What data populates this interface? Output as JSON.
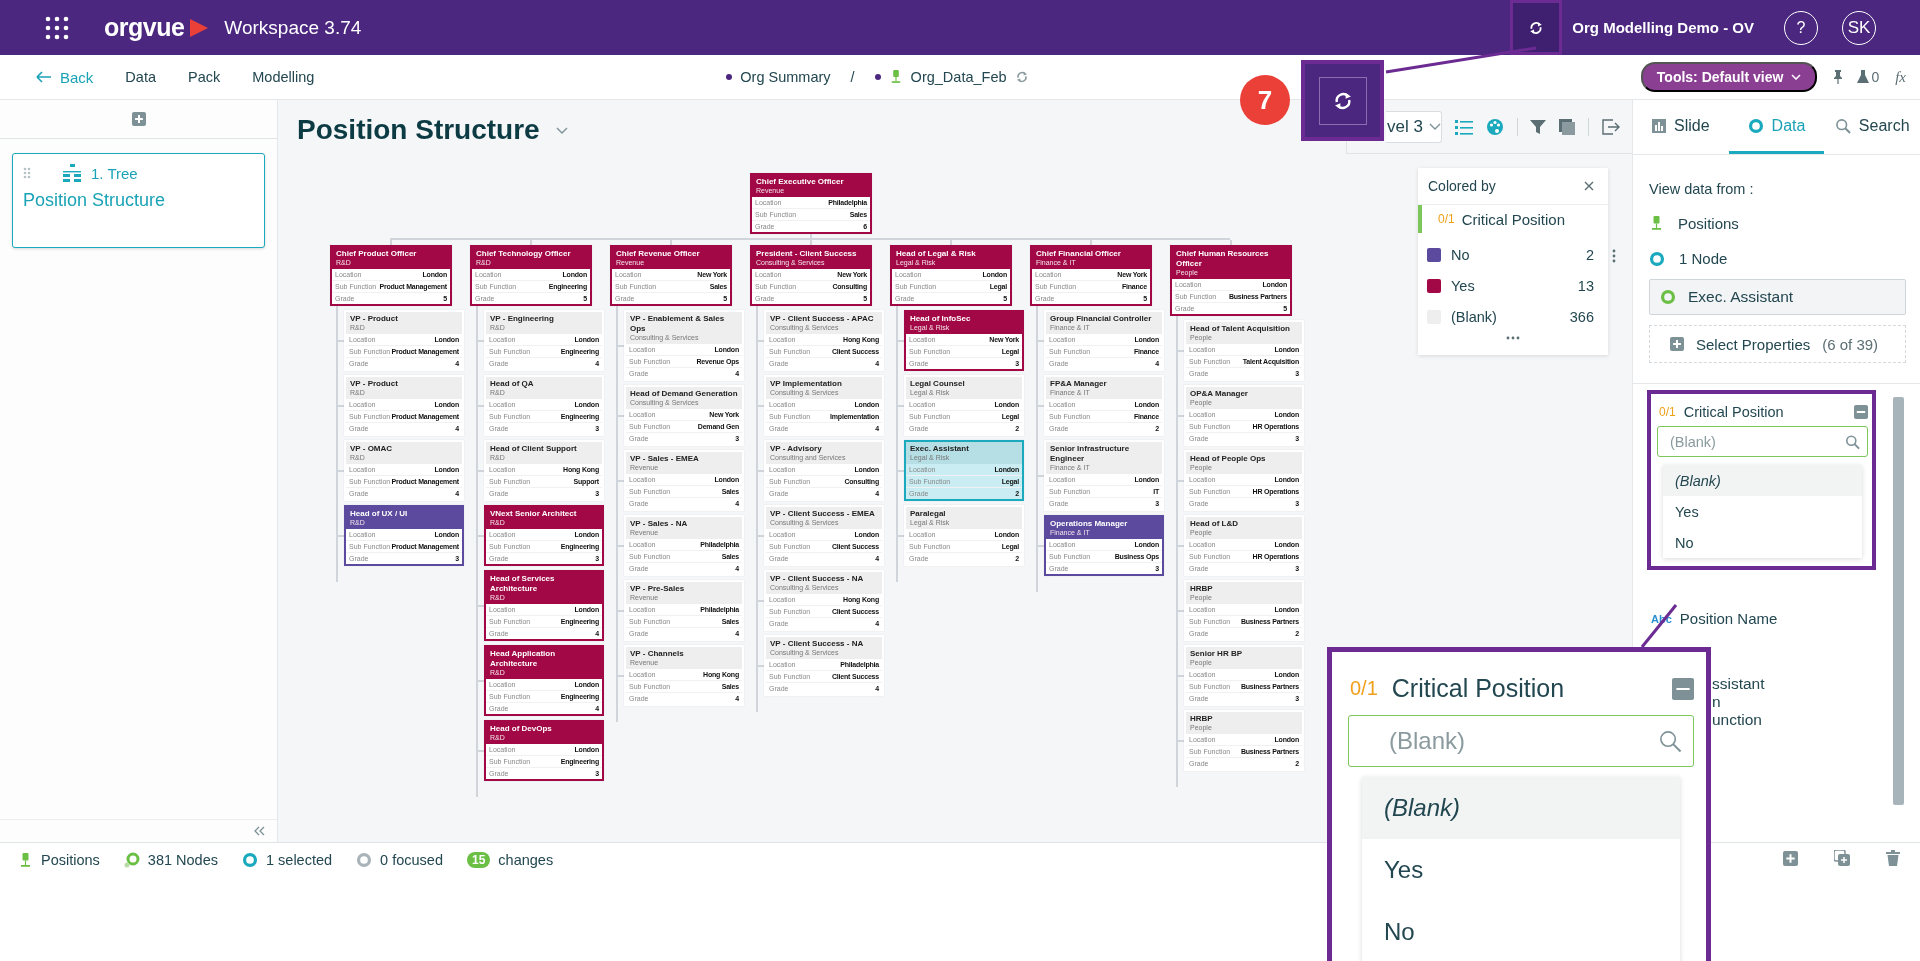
{
  "top_bar": {
    "app_name": "orgvue",
    "workspace": "Workspace 3.74",
    "workspace_name": "Org Modelling Demo - OV",
    "help": "?",
    "user_initials": "SK"
  },
  "nav": {
    "back": "Back",
    "links": [
      "Data",
      "Pack",
      "Modelling"
    ],
    "breadcrumb": [
      "Org Summary",
      "Org_Data_Feb"
    ],
    "separator": "/",
    "tools_button": "Tools: Default view",
    "flask_count": "0",
    "formula": "fx"
  },
  "slides_panel": {
    "slides": [
      {
        "number_label": "1. Tree",
        "title": "Position Structure",
        "selected": true
      }
    ]
  },
  "view": {
    "title": "Position Structure",
    "level_select": "vel 3"
  },
  "legend": {
    "title": "Colored by",
    "property_type": "0/1",
    "property": "Critical Position",
    "entries": [
      {
        "label": "No",
        "count": "2",
        "color": "#5c4a9e"
      },
      {
        "label": "Yes",
        "count": "13",
        "color": "#a10845"
      },
      {
        "label": "(Blank)",
        "count": "366",
        "color": "#eeeeee"
      }
    ]
  },
  "org_chart": {
    "root": {
      "title": "Chief Executive Officer",
      "function": "Revenue",
      "fields": [
        [
          "Location",
          "Philadelphia"
        ],
        [
          "Sub Function",
          "Sales"
        ],
        [
          "Grade",
          "6"
        ]
      ],
      "color": "#a10845",
      "selected": false,
      "children": [
        {
          "title": "Chief Product Officer",
          "function": "R&D",
          "fields": [
            [
              "Location",
              "London"
            ],
            [
              "Sub Function",
              "Product Management"
            ],
            [
              "Grade",
              "5"
            ]
          ],
          "color": "#a10845",
          "selected": false,
          "children": [
            {
              "title": "VP - Product",
              "function": "R&D",
              "fields": [
                [
                  "Location",
                  "London"
                ],
                [
                  "Sub Function",
                  "Product Management"
                ],
                [
                  "Grade",
                  "4"
                ]
              ],
              "selected": false
            },
            {
              "title": "VP - Product",
              "function": "R&D",
              "fields": [
                [
                  "Location",
                  "London"
                ],
                [
                  "Sub Function",
                  "Product Management"
                ],
                [
                  "Grade",
                  "4"
                ]
              ],
              "selected": false
            },
            {
              "title": "VP - OMAC",
              "function": "R&D",
              "fields": [
                [
                  "Location",
                  "London"
                ],
                [
                  "Sub Function",
                  "Product Management"
                ],
                [
                  "Grade",
                  "4"
                ]
              ],
              "selected": false
            },
            {
              "title": "Head of UX / UI",
              "function": "R&D",
              "fields": [
                [
                  "Location",
                  "London"
                ],
                [
                  "Sub Function",
                  "Product Management"
                ],
                [
                  "Grade",
                  "3"
                ]
              ],
              "color": "#5c4a9e",
              "selected": false
            }
          ]
        },
        {
          "title": "Chief Technology Officer",
          "function": "R&D",
          "fields": [
            [
              "Location",
              "London"
            ],
            [
              "Sub Function",
              "Engineering"
            ],
            [
              "Grade",
              "5"
            ]
          ],
          "color": "#a10845",
          "selected": false,
          "children": [
            {
              "title": "VP - Engineering",
              "function": "R&D",
              "fields": [
                [
                  "Location",
                  "London"
                ],
                [
                  "Sub Function",
                  "Engineering"
                ],
                [
                  "Grade",
                  "4"
                ]
              ],
              "selected": false
            },
            {
              "title": "Head of QA",
              "function": "R&D",
              "fields": [
                [
                  "Location",
                  "London"
                ],
                [
                  "Sub Function",
                  "Engineering"
                ],
                [
                  "Grade",
                  "3"
                ]
              ],
              "selected": false
            },
            {
              "title": "Head of Client Support",
              "function": "R&D",
              "fields": [
                [
                  "Location",
                  "Hong Kong"
                ],
                [
                  "Sub Function",
                  "Support"
                ],
                [
                  "Grade",
                  "3"
                ]
              ],
              "selected": false
            },
            {
              "title": "VNext Senior Architect",
              "function": "R&D",
              "fields": [
                [
                  "Location",
                  "London"
                ],
                [
                  "Sub Function",
                  "Engineering"
                ],
                [
                  "Grade",
                  "3"
                ]
              ],
              "color": "#a10845",
              "selected": false
            },
            {
              "title": "Head of Services Architecture",
              "function": "R&D",
              "fields": [
                [
                  "Location",
                  "London"
                ],
                [
                  "Sub Function",
                  "Engineering"
                ],
                [
                  "Grade",
                  "4"
                ]
              ],
              "color": "#a10845",
              "selected": false
            },
            {
              "title": "Head Application Architecture",
              "function": "R&D",
              "fields": [
                [
                  "Location",
                  "London"
                ],
                [
                  "Sub Function",
                  "Engineering"
                ],
                [
                  "Grade",
                  "4"
                ]
              ],
              "color": "#a10845",
              "selected": false
            },
            {
              "title": "Head of DevOps",
              "function": "R&D",
              "fields": [
                [
                  "Location",
                  "London"
                ],
                [
                  "Sub Function",
                  "Engineering"
                ],
                [
                  "Grade",
                  "3"
                ]
              ],
              "color": "#a10845",
              "selected": false
            }
          ]
        },
        {
          "title": "Chief Revenue Officer",
          "function": "Revenue",
          "fields": [
            [
              "Location",
              "New York"
            ],
            [
              "Sub Function",
              "Sales"
            ],
            [
              "Grade",
              "5"
            ]
          ],
          "color": "#a10845",
          "selected": false,
          "children": [
            {
              "title": "VP - Enablement & Sales Ops",
              "function": "Consulting & Services",
              "fields": [
                [
                  "Location",
                  "London"
                ],
                [
                  "Sub Function",
                  "Revenue Ops"
                ],
                [
                  "Grade",
                  "4"
                ]
              ],
              "selected": false
            },
            {
              "title": "Head of Demand Generation",
              "function": "Consulting & Services",
              "fields": [
                [
                  "Location",
                  "New York"
                ],
                [
                  "Sub Function",
                  "Demand Gen"
                ],
                [
                  "Grade",
                  "3"
                ]
              ],
              "selected": false
            },
            {
              "title": "VP - Sales - EMEA",
              "function": "Revenue",
              "fields": [
                [
                  "Location",
                  "London"
                ],
                [
                  "Sub Function",
                  "Sales"
                ],
                [
                  "Grade",
                  "4"
                ]
              ],
              "selected": false
            },
            {
              "title": "VP - Sales - NA",
              "function": "Revenue",
              "fields": [
                [
                  "Location",
                  "Philadelphia"
                ],
                [
                  "Sub Function",
                  "Sales"
                ],
                [
                  "Grade",
                  "4"
                ]
              ],
              "selected": false
            },
            {
              "title": "VP - Pre-Sales",
              "function": "Revenue",
              "fields": [
                [
                  "Location",
                  "Philadelphia"
                ],
                [
                  "Sub Function",
                  "Sales"
                ],
                [
                  "Grade",
                  "4"
                ]
              ],
              "selected": false
            },
            {
              "title": "VP - Channels",
              "function": "Revenue",
              "fields": [
                [
                  "Location",
                  "Hong Kong"
                ],
                [
                  "Sub Function",
                  "Sales"
                ],
                [
                  "Grade",
                  "4"
                ]
              ],
              "selected": false
            }
          ]
        },
        {
          "title": "President - Client Success",
          "function": "Consulting & Services",
          "fields": [
            [
              "Location",
              "New York"
            ],
            [
              "Sub Function",
              "Consulting"
            ],
            [
              "Grade",
              "5"
            ]
          ],
          "color": "#a10845",
          "selected": false,
          "children": [
            {
              "title": "VP - Client Success - APAC",
              "function": "Consulting & Services",
              "fields": [
                [
                  "Location",
                  "Hong Kong"
                ],
                [
                  "Sub Function",
                  "Client Success"
                ],
                [
                  "Grade",
                  "4"
                ]
              ],
              "selected": false
            },
            {
              "title": "VP Implementation",
              "function": "Consulting & Services",
              "fields": [
                [
                  "Location",
                  "London"
                ],
                [
                  "Sub Function",
                  "Implementation"
                ],
                [
                  "Grade",
                  "4"
                ]
              ],
              "selected": false
            },
            {
              "title": "VP - Advisory",
              "function": "Consulting and Services",
              "fields": [
                [
                  "Location",
                  "London"
                ],
                [
                  "Sub Function",
                  "Consulting"
                ],
                [
                  "Grade",
                  "4"
                ]
              ],
              "selected": false
            },
            {
              "title": "VP - Client Success - EMEA",
              "function": "Consulting & Services",
              "fields": [
                [
                  "Location",
                  "London"
                ],
                [
                  "Sub Function",
                  "Client Success"
                ],
                [
                  "Grade",
                  "4"
                ]
              ],
              "selected": false
            },
            {
              "title": "VP - Client Success - NA",
              "function": "Consulting & Services",
              "fields": [
                [
                  "Location",
                  "Hong Kong"
                ],
                [
                  "Sub Function",
                  "Client Success"
                ],
                [
                  "Grade",
                  "4"
                ]
              ],
              "selected": false
            },
            {
              "title": "VP - Client Success - NA",
              "function": "Consulting & Services",
              "fields": [
                [
                  "Location",
                  "Philadelphia"
                ],
                [
                  "Sub Function",
                  "Client Success"
                ],
                [
                  "Grade",
                  "4"
                ]
              ],
              "selected": false
            }
          ]
        },
        {
          "title": "Head of Legal & Risk",
          "function": "Legal & Risk",
          "fields": [
            [
              "Location",
              "London"
            ],
            [
              "Sub Function",
              "Legal"
            ],
            [
              "Grade",
              "5"
            ]
          ],
          "color": "#a10845",
          "selected": false,
          "children": [
            {
              "title": "Head of InfoSec",
              "function": "Legal & Risk",
              "fields": [
                [
                  "Location",
                  "New York"
                ],
                [
                  "Sub Function",
                  "Legal"
                ],
                [
                  "Grade",
                  "3"
                ]
              ],
              "color": "#a10845",
              "selected": false
            },
            {
              "title": "Legal Counsel",
              "function": "Legal & Risk",
              "fields": [
                [
                  "Location",
                  "London"
                ],
                [
                  "Sub Function",
                  "Legal"
                ],
                [
                  "Grade",
                  "2"
                ]
              ],
              "selected": false
            },
            {
              "title": "Exec. Assistant",
              "function": "Legal & Risk",
              "fields": [
                [
                  "Location",
                  "London"
                ],
                [
                  "Sub Function",
                  "Legal"
                ],
                [
                  "Grade",
                  "2"
                ]
              ],
              "selected": true
            },
            {
              "title": "Paralegal",
              "function": "Legal & Risk",
              "fields": [
                [
                  "Location",
                  "London"
                ],
                [
                  "Sub Function",
                  "Legal"
                ],
                [
                  "Grade",
                  "2"
                ]
              ],
              "selected": false
            }
          ]
        },
        {
          "title": "Chief Financial Officer",
          "function": "Finance & IT",
          "fields": [
            [
              "Location",
              "New York"
            ],
            [
              "Sub Function",
              "Finance"
            ],
            [
              "Grade",
              "5"
            ]
          ],
          "color": "#a10845",
          "selected": false,
          "children": [
            {
              "title": "Group Financial Controller",
              "function": "Finance & IT",
              "fields": [
                [
                  "Location",
                  "London"
                ],
                [
                  "Sub Function",
                  "Finance"
                ],
                [
                  "Grade",
                  "4"
                ]
              ],
              "selected": false
            },
            {
              "title": "FP&A Manager",
              "function": "Finance & IT",
              "fields": [
                [
                  "Location",
                  "London"
                ],
                [
                  "Sub Function",
                  "Finance"
                ],
                [
                  "Grade",
                  "2"
                ]
              ],
              "selected": false
            },
            {
              "title": "Senior Infrastructure Engineer",
              "function": "Finance & IT",
              "fields": [
                [
                  "Location",
                  "London"
                ],
                [
                  "Sub Function",
                  "IT"
                ],
                [
                  "Grade",
                  "3"
                ]
              ],
              "selected": false
            },
            {
              "title": "Operations Manager",
              "function": "Finance & IT",
              "fields": [
                [
                  "Location",
                  "London"
                ],
                [
                  "Sub Function",
                  "Business Ops"
                ],
                [
                  "Grade",
                  "3"
                ]
              ],
              "color": "#5c4a9e",
              "selected": false
            }
          ]
        },
        {
          "title": "Chief Human Resources Officer",
          "function": "People",
          "fields": [
            [
              "Location",
              "London"
            ],
            [
              "Sub Function",
              "Business Partners"
            ],
            [
              "Grade",
              "5"
            ]
          ],
          "color": "#a10845",
          "selected": false,
          "children": [
            {
              "title": "Head of Talent Acquisition",
              "function": "People",
              "fields": [
                [
                  "Location",
                  "London"
                ],
                [
                  "Sub Function",
                  "Talent Acquisition"
                ],
                [
                  "Grade",
                  "3"
                ]
              ],
              "selected": false
            },
            {
              "title": "OP&A Manager",
              "function": "People",
              "fields": [
                [
                  "Location",
                  "London"
                ],
                [
                  "Sub Function",
                  "HR Operations"
                ],
                [
                  "Grade",
                  "3"
                ]
              ],
              "selected": false
            },
            {
              "title": "Head of People Ops",
              "function": "People",
              "fields": [
                [
                  "Location",
                  "London"
                ],
                [
                  "Sub Function",
                  "HR Operations"
                ],
                [
                  "Grade",
                  "3"
                ]
              ],
              "selected": false
            },
            {
              "title": "Head of L&D",
              "function": "People",
              "fields": [
                [
                  "Location",
                  "London"
                ],
                [
                  "Sub Function",
                  "HR Operations"
                ],
                [
                  "Grade",
                  "3"
                ]
              ],
              "selected": false
            },
            {
              "title": "HRBP",
              "function": "People",
              "fields": [
                [
                  "Location",
                  "London"
                ],
                [
                  "Sub Function",
                  "Business Partners"
                ],
                [
                  "Grade",
                  "2"
                ]
              ],
              "selected": false
            },
            {
              "title": "Senior HR BP",
              "function": "People",
              "fields": [
                [
                  "Location",
                  "London"
                ],
                [
                  "Sub Function",
                  "Business Partners"
                ],
                [
                  "Grade",
                  "3"
                ]
              ],
              "selected": false
            },
            {
              "title": "HRBP",
              "function": "People",
              "fields": [
                [
                  "Location",
                  "London"
                ],
                [
                  "Sub Function",
                  "Business Partners"
                ],
                [
                  "Grade",
                  "2"
                ]
              ],
              "selected": false
            }
          ]
        }
      ]
    }
  },
  "right_panel": {
    "tabs": [
      {
        "label": "Slide",
        "selected": false
      },
      {
        "label": "Data",
        "selected": true
      },
      {
        "label": "Search",
        "selected": false
      }
    ],
    "view_data_from": "View data from :",
    "dataset": "Positions",
    "node_count": "1 Node",
    "node_name": "Exec. Assistant",
    "select_properties": "Select Properties",
    "properties_count": "(6 of 39)",
    "filter": {
      "property_type": "0/1",
      "property": "Critical Position",
      "placeholder": "(Blank)",
      "options": [
        {
          "label": "(Blank)",
          "selected": true
        },
        {
          "label": "Yes",
          "selected": false
        },
        {
          "label": "No",
          "selected": false
        }
      ]
    },
    "property_type": "Abc",
    "property_name": "Position Name",
    "partial_texts": [
      "ssistant",
      "n",
      "unction"
    ]
  },
  "status_bar": {
    "dataset": "Positions",
    "nodes": "381 Nodes",
    "selected": "1 selected",
    "focused": "0 focused",
    "changes_count": "15",
    "changes": "changes"
  },
  "callouts": {
    "step_number": "7",
    "magnified_filter": {
      "property_type": "0/1",
      "property": "Critical Position",
      "placeholder": "(Blank)",
      "options": [
        {
          "label": "(Blank)",
          "selected": true
        },
        {
          "label": "Yes",
          "selected": false
        },
        {
          "label": "No",
          "selected": false
        }
      ]
    }
  }
}
